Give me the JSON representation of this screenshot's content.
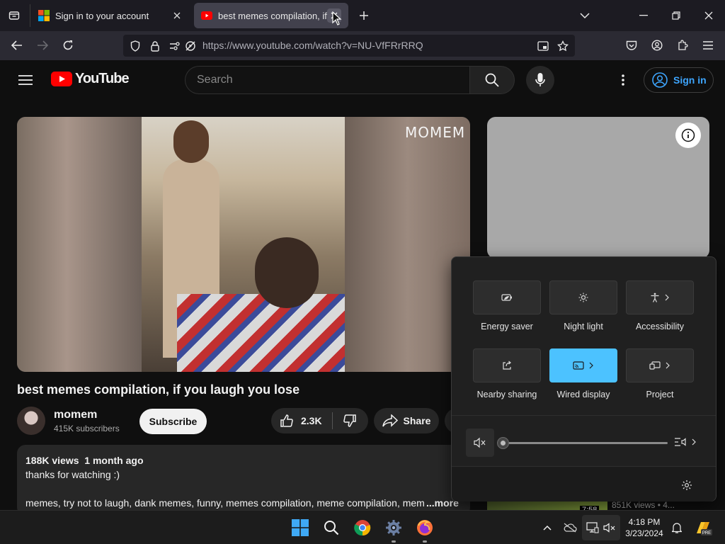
{
  "browser": {
    "tabs": [
      {
        "title": "Sign in to your account"
      },
      {
        "title": "best memes compilation, if yo"
      }
    ],
    "url": "https://www.youtube.com/watch?v=NU-VfFRrRRQ"
  },
  "youtube": {
    "logo_text": "YouTube",
    "search_placeholder": "Search",
    "signin_label": "Sign in",
    "video_watermark": "MOMEM",
    "video_title": "best memes compilation, if you laugh you lose",
    "channel": {
      "name": "momem",
      "subscribers": "415K subscribers"
    },
    "subscribe_label": "Subscribe",
    "likes": "2.3K",
    "share_label": "Share",
    "description": {
      "stats": "188K views  1 month ago",
      "line1": "thanks for watching :)",
      "tags": "memes, try not to laugh, dank memes, funny, memes compilation, meme compilation, mem",
      "more": "...more"
    },
    "sidebar_meta": "851K views  • 4...",
    "sidebar_duration": "7:58"
  },
  "quick_settings": {
    "tiles": [
      {
        "label": "Energy saver",
        "icon": "energy-saver-icon",
        "active": false
      },
      {
        "label": "Night light",
        "icon": "night-light-icon",
        "active": false
      },
      {
        "label": "Accessibility",
        "icon": "accessibility-icon",
        "active": false
      },
      {
        "label": "Nearby sharing",
        "icon": "nearby-sharing-icon",
        "active": false
      },
      {
        "label": "Wired display",
        "icon": "cast-icon",
        "active": true
      },
      {
        "label": "Project",
        "icon": "project-icon",
        "active": false
      }
    ],
    "volume_level": 0
  },
  "taskbar": {
    "time": "4:18 PM",
    "date": "3/23/2024"
  },
  "colors": {
    "youtube_red": "#ff0000",
    "accent_blue": "#4cc2ff",
    "link_blue": "#3ea6ff"
  }
}
